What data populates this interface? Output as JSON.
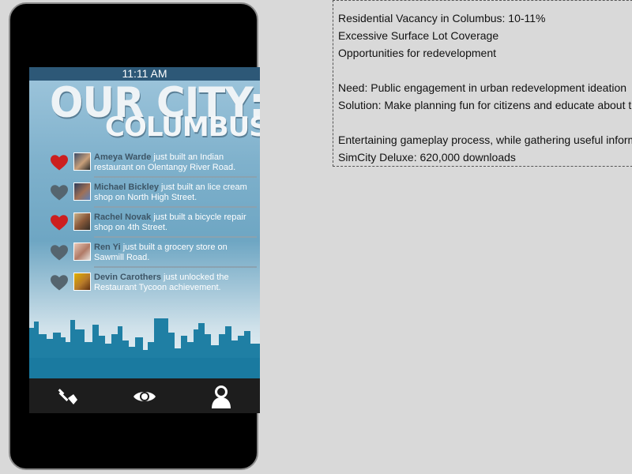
{
  "phone": {
    "status_time": "11:11 AM",
    "title_line1": "OUR CITY:",
    "title_line2": "COLUMBUS",
    "feed": [
      {
        "name": "Ameya Warde",
        "text": "just built an Indian restaurant on Olentangy River Road.",
        "liked": true
      },
      {
        "name": "Michael Bickley",
        "text": "just built an lice cream shop on North High Street.",
        "liked": false
      },
      {
        "name": "Rachel Novak",
        "text": "just built a bicycle repair shop on 4th Street.",
        "liked": true
      },
      {
        "name": "Ren Yi",
        "text": "just built a grocery store on Sawmill Road.",
        "liked": false
      },
      {
        "name": "Devin Carothers",
        "text": "just unlocked the Restaurant Tycoon achievement.",
        "liked": false
      }
    ],
    "nav": [
      "shovel-icon",
      "eye-icon",
      "user-icon"
    ],
    "colors": {
      "liked_heart": "#cc1f1f",
      "unliked_heart": "#55656f",
      "status_bar": "#2d5877",
      "skyline": "#1f7fa4"
    }
  },
  "notes": {
    "lines": [
      "Residential Vacancy in Columbus: 10-11%",
      "Excessive Surface Lot Coverage",
      "Opportunities for redevelopment",
      "",
      "Need: Public engagement in urban redevelopment ideation",
      "Solution: Make planning fun for citizens and educate about t",
      "",
      "Entertaining gameplay process, while gathering useful inform",
      "SimCity Deluxe: 620,000 downloads"
    ]
  }
}
